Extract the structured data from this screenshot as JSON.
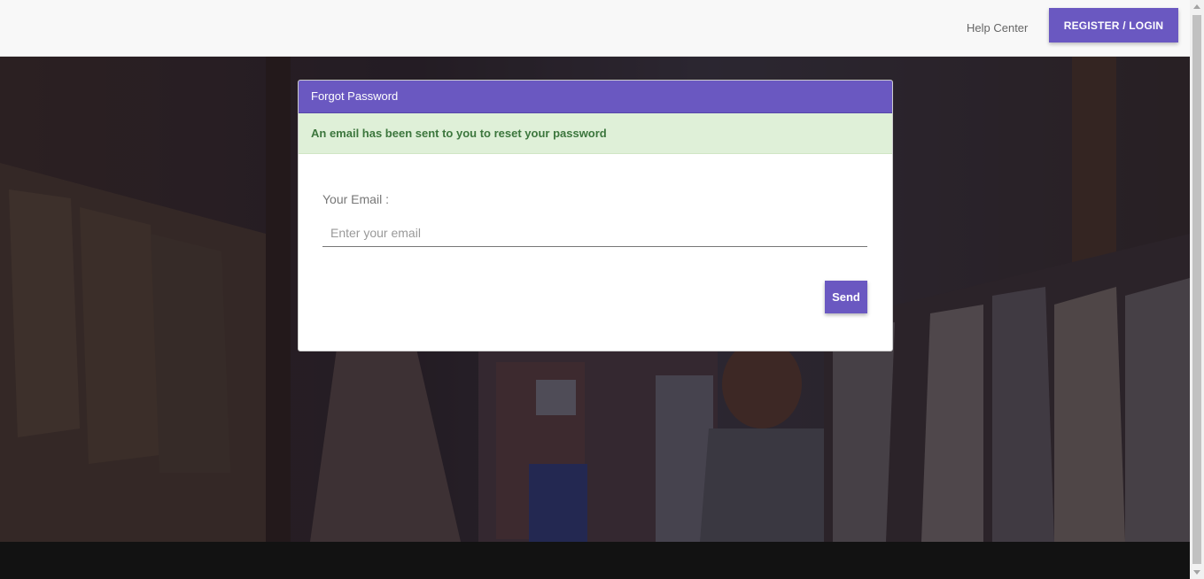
{
  "header": {
    "help_label": "Help Center",
    "register_label": "REGISTER / LOGIN"
  },
  "card": {
    "title": "Forgot Password",
    "alert_message": "An email has been sent to you to reset your password",
    "email_label": "Your Email :",
    "email_placeholder": "Enter your email",
    "email_value": "",
    "send_label": "Send"
  },
  "colors": {
    "accent": "#6a58c1",
    "alert_bg": "#dff0d8",
    "alert_text": "#3c763d"
  }
}
